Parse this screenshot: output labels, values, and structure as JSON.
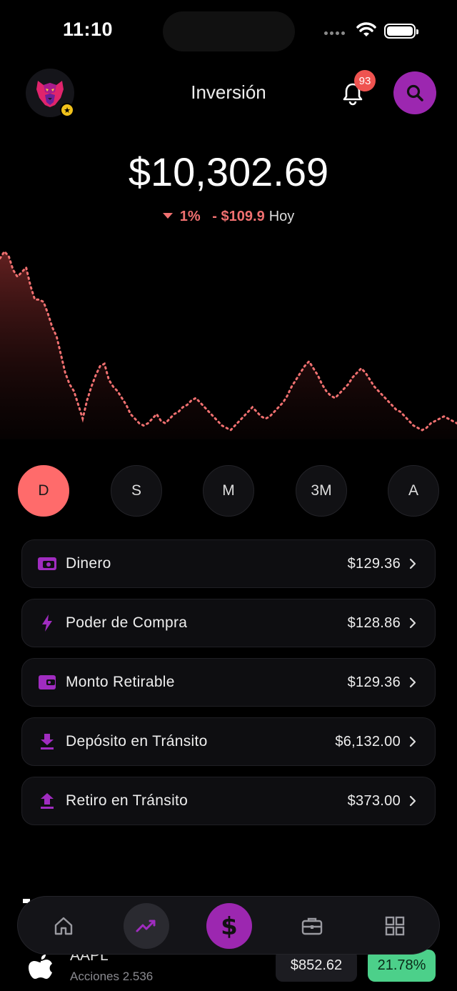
{
  "status": {
    "time": "11:10"
  },
  "header": {
    "title": "Inversión",
    "notification_count": "93"
  },
  "portfolio": {
    "balance": "$10,302.69",
    "change_percent": "1%",
    "change_amount": "- $109.9",
    "change_period": "Hoy",
    "trend": "down"
  },
  "chart_data": {
    "type": "line",
    "x_label": "",
    "y_label": "",
    "y_values": [
      100,
      103,
      101,
      95,
      92,
      94,
      96,
      88,
      82,
      82,
      81,
      76,
      70,
      66,
      58,
      50,
      45,
      42,
      36,
      30,
      38,
      44,
      49,
      53,
      54,
      47,
      44,
      42,
      39,
      36,
      32,
      30,
      28,
      27,
      28,
      30,
      32,
      29,
      28,
      30,
      32,
      33,
      35,
      36,
      38,
      39,
      37,
      35,
      33,
      31,
      29,
      27,
      26,
      25,
      27,
      29,
      31,
      33,
      35,
      33,
      31,
      30,
      31,
      33,
      35,
      37,
      40,
      44,
      47,
      50,
      53,
      55,
      52,
      49,
      45,
      42,
      40,
      39,
      41,
      43,
      45,
      48,
      50,
      52,
      50,
      47,
      44,
      42,
      40,
      38,
      36,
      34,
      33,
      31,
      29,
      27,
      26,
      25,
      26,
      28,
      29,
      30,
      31,
      30,
      29,
      28
    ],
    "color": "#f07070"
  },
  "ranges": [
    "D",
    "S",
    "M",
    "3M",
    "A"
  ],
  "active_range": "D",
  "accounts": [
    {
      "icon": "cash-icon",
      "label": "Dinero",
      "value": "$129.36"
    },
    {
      "icon": "lightning-icon",
      "label": "Poder de Compra",
      "value": "$128.86"
    },
    {
      "icon": "wallet-icon",
      "label": "Monto Retirable",
      "value": "$129.36"
    },
    {
      "icon": "download-icon",
      "label": "Depósito en Tránsito",
      "value": "$6,132.00"
    },
    {
      "icon": "upload-icon",
      "label": "Retiro en Tránsito",
      "value": "$373.00"
    }
  ],
  "holding": {
    "ticker": "AAPL",
    "shares": "Acciones 2.536",
    "price": "$852.62",
    "change": "21.78%"
  },
  "colors": {
    "accent": "#9c27b0",
    "negative": "#f07070",
    "positive": "#4cd08a",
    "active_range": "#ff6b6b"
  },
  "tabbar": [
    "home-icon",
    "trend-icon",
    "dollar-icon",
    "briefcase-icon",
    "grid-icon"
  ]
}
